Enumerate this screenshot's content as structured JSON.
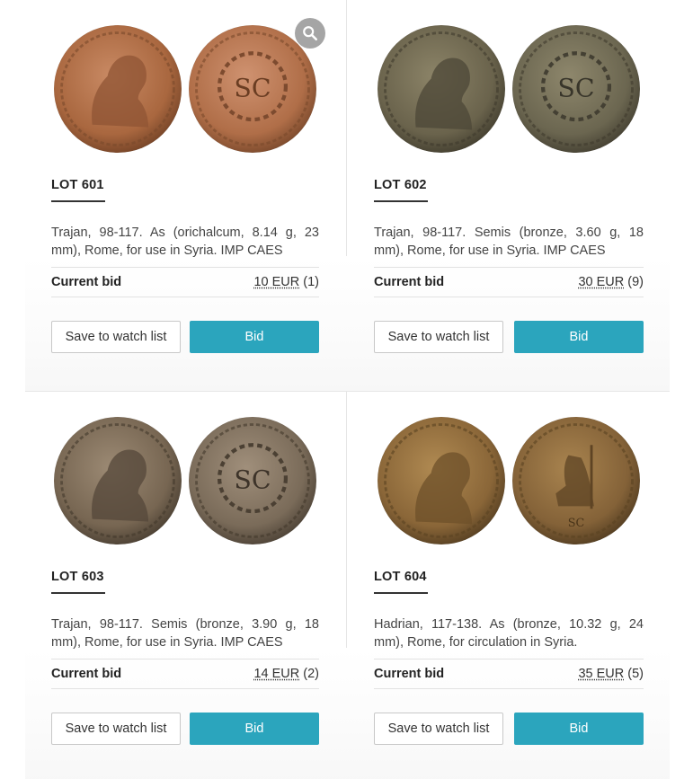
{
  "common": {
    "bid_label": "Current bid",
    "watch_label": "Save to watch list",
    "bid_button_label": "Bid",
    "zoom_icon": "magnifier-icon",
    "accent_color": "#2ba5bd"
  },
  "lots": [
    {
      "title": "LOT 601",
      "description": "Trajan, 98-117. As (orichalcum, 8.14 g, 23 mm), Rome, for use in Syria. IMP CAES",
      "bid_amount": "10 EUR",
      "bid_count": "(1)",
      "obverse_color": "#b3734f",
      "reverse_color": "#b87a58"
    },
    {
      "title": "LOT 602",
      "description": "Trajan, 98-117. Semis (bronze, 3.60 g, 18 mm), Rome, for use in Syria. IMP CAES",
      "bid_amount": "30 EUR",
      "bid_count": "(9)",
      "obverse_color": "#6d6650",
      "reverse_color": "#6f6a55"
    },
    {
      "title": "LOT 603",
      "description": "Trajan, 98-117. Semis (bronze, 3.90 g, 18 mm), Rome, for use in Syria. IMP CAES",
      "bid_amount": "14 EUR",
      "bid_count": "(2)",
      "obverse_color": "#7c6b57",
      "reverse_color": "#7e6f5e"
    },
    {
      "title": "LOT 604",
      "description": "Hadrian, 117-138. As (bronze, 10.32 g, 24 mm), Rome, for circulation in Syria.",
      "bid_amount": "35 EUR",
      "bid_count": "(5)",
      "obverse_color": "#8d6a3b",
      "reverse_color": "#86663d"
    }
  ]
}
